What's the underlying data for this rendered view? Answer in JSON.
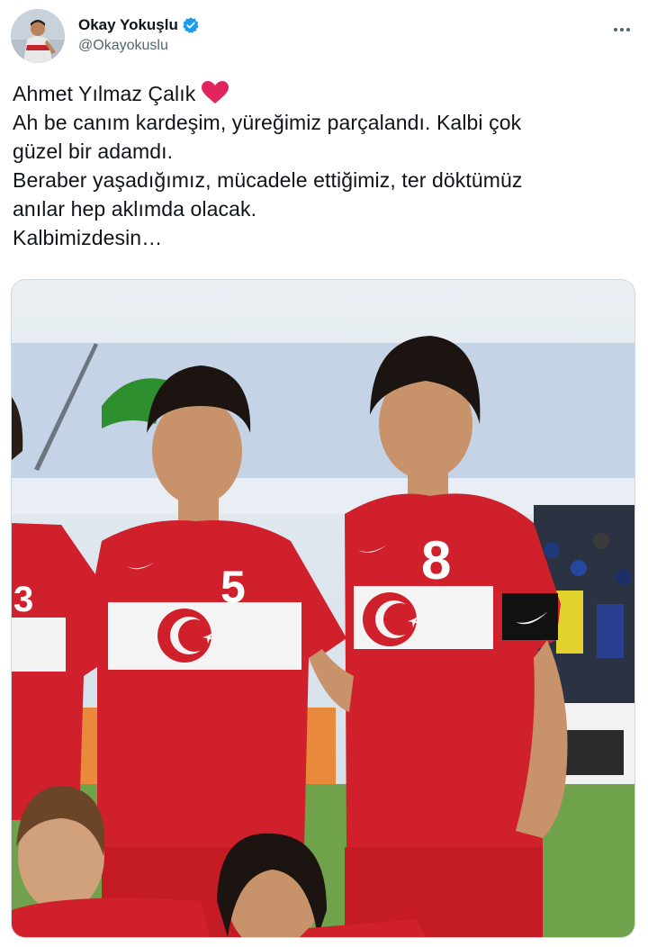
{
  "user": {
    "display_name": "Okay Yokuşlu",
    "handle": "@Okayokuslu",
    "verified": true,
    "avatar_icon": "avatar-photo"
  },
  "menu": {
    "icon": "more-horizontal-icon"
  },
  "tweet": {
    "lines": [
      "Ahmet Yılmaz Çalık",
      "Ah be canım kardeşim, yüreğimiz parçalandı. Kalbi çok",
      "güzel bir adamdı.",
      "Beraber yaşadığımız, mücadele ettiğimiz, ter döktümüz",
      "anılar hep aklımda olacak.",
      "Kalbimizdesin…"
    ],
    "emoji": "red-heart-icon"
  },
  "media": {
    "jersey_numbers": [
      "5",
      "8",
      "3"
    ],
    "colors": {
      "jersey_red": "#d0202b",
      "verified_blue": "#1d9bf0",
      "heart_red": "#e0245e"
    }
  }
}
